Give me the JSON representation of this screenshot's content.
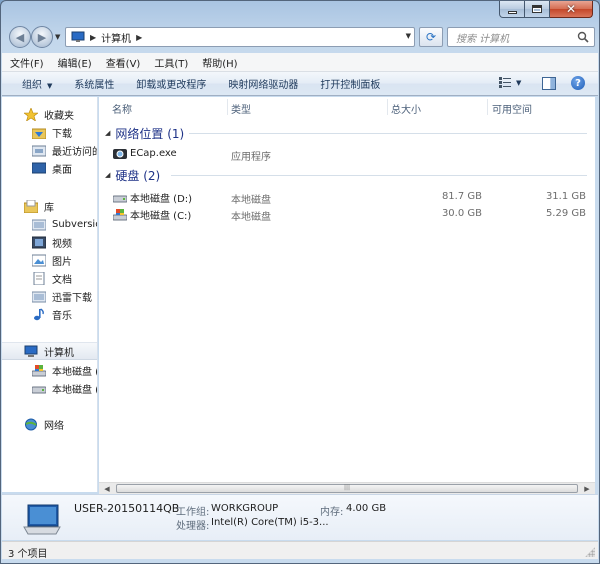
{
  "addressbar": {
    "path_label": "计算机"
  },
  "search": {
    "placeholder": "搜索 计算机"
  },
  "menubar": {
    "items": [
      "文件(F)",
      "编辑(E)",
      "查看(V)",
      "工具(T)",
      "帮助(H)"
    ]
  },
  "toolbar": {
    "organize": "组织",
    "items": [
      "系统属性",
      "卸载或更改程序",
      "映射网络驱动器",
      "打开控制面板"
    ]
  },
  "sidebar": {
    "favorites": {
      "label": "收藏夹",
      "items": [
        "下载",
        "最近访问的",
        "桌面"
      ]
    },
    "libraries": {
      "label": "库",
      "items": [
        "Subversion",
        "视频",
        "图片",
        "文档",
        "迅雷下载",
        "音乐"
      ]
    },
    "computer": {
      "label": "计算机",
      "items": [
        "本地磁盘 (C",
        "本地磁盘 (D"
      ]
    },
    "network": {
      "label": "网络"
    }
  },
  "columns": {
    "name": "名称",
    "type": "类型",
    "total": "总大小",
    "free": "可用空间"
  },
  "groups": {
    "network": {
      "label": "网络位置 (1)",
      "items": [
        {
          "name": "ECap.exe",
          "type": "应用程序"
        }
      ]
    },
    "drives": {
      "label": "硬盘 (2)",
      "items": [
        {
          "name": "本地磁盘 (D:)",
          "type": "本地磁盘",
          "total": "81.7 GB",
          "free": "31.1 GB"
        },
        {
          "name": "本地磁盘 (C:)",
          "type": "本地磁盘",
          "total": "30.0 GB",
          "free": "5.29 GB"
        }
      ]
    }
  },
  "details": {
    "name": "USER-20150114QB",
    "workgroup_label": "工作组:",
    "workgroup": "WORKGROUP",
    "memory_label": "内存:",
    "memory": "4.00 GB",
    "processor_label": "处理器:",
    "processor": "Intel(R) Core(TM) i5-3..."
  },
  "status": {
    "text": "3 个项目"
  },
  "colors": {
    "group_header": "#1e3287",
    "accent": "#2c74c4"
  }
}
